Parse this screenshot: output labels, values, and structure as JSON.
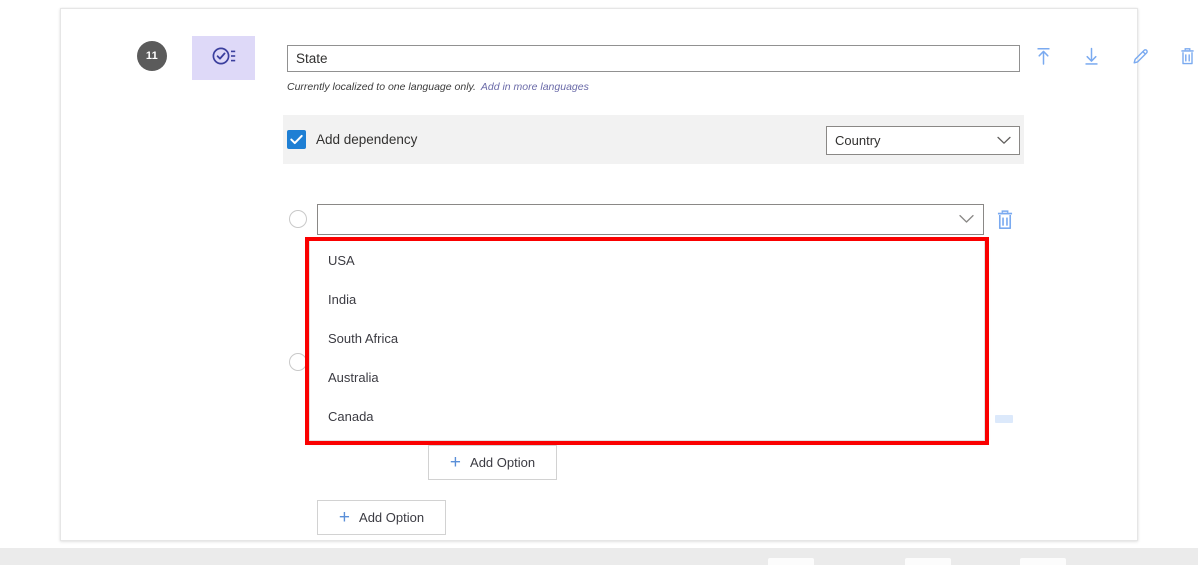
{
  "card": {
    "question": {
      "index_badge": "11",
      "type_icon": "checklist-circle-icon",
      "title_value": "State",
      "title_placeholder": "Enter question title",
      "localization_note": "Currently localized to one language only.",
      "localization_link": "Add in more languages"
    },
    "row_tools": [
      {
        "name": "move-to-top-icon",
        "label": "Move to top"
      },
      {
        "name": "move-to-bottom-icon",
        "label": "Move to bottom"
      },
      {
        "name": "edit-pencil-icon",
        "label": "Edit"
      },
      {
        "name": "delete-trash-icon",
        "label": "Delete"
      }
    ],
    "dependency": {
      "checkbox_checked": true,
      "label": "Add dependency",
      "select_value": "Country",
      "select_placeholder": "Select a question"
    },
    "option_row": {
      "radio_selected": false,
      "combo_value": "",
      "combo_placeholder": "",
      "delete_icon": "delete-trash-icon"
    },
    "dropdown": {
      "open": true,
      "options": [
        "USA",
        "India",
        "South Africa",
        "Australia",
        "Canada"
      ]
    },
    "buttons": {
      "add_option_inner": "Add Option",
      "add_option_outer": "Add Option",
      "plus_glyph": "+"
    }
  },
  "annotation": {
    "highlight_color": "#fa0000",
    "shape": "rectangle"
  },
  "colors": {
    "accent_blue": "#1e7fd4",
    "icon_blue": "#7aaaf0",
    "tile_lavender": "#ded9f8",
    "badge_gray": "#5b5b5b",
    "band_gray": "#f2f2f2",
    "link_purple": "#6a6aa8"
  }
}
